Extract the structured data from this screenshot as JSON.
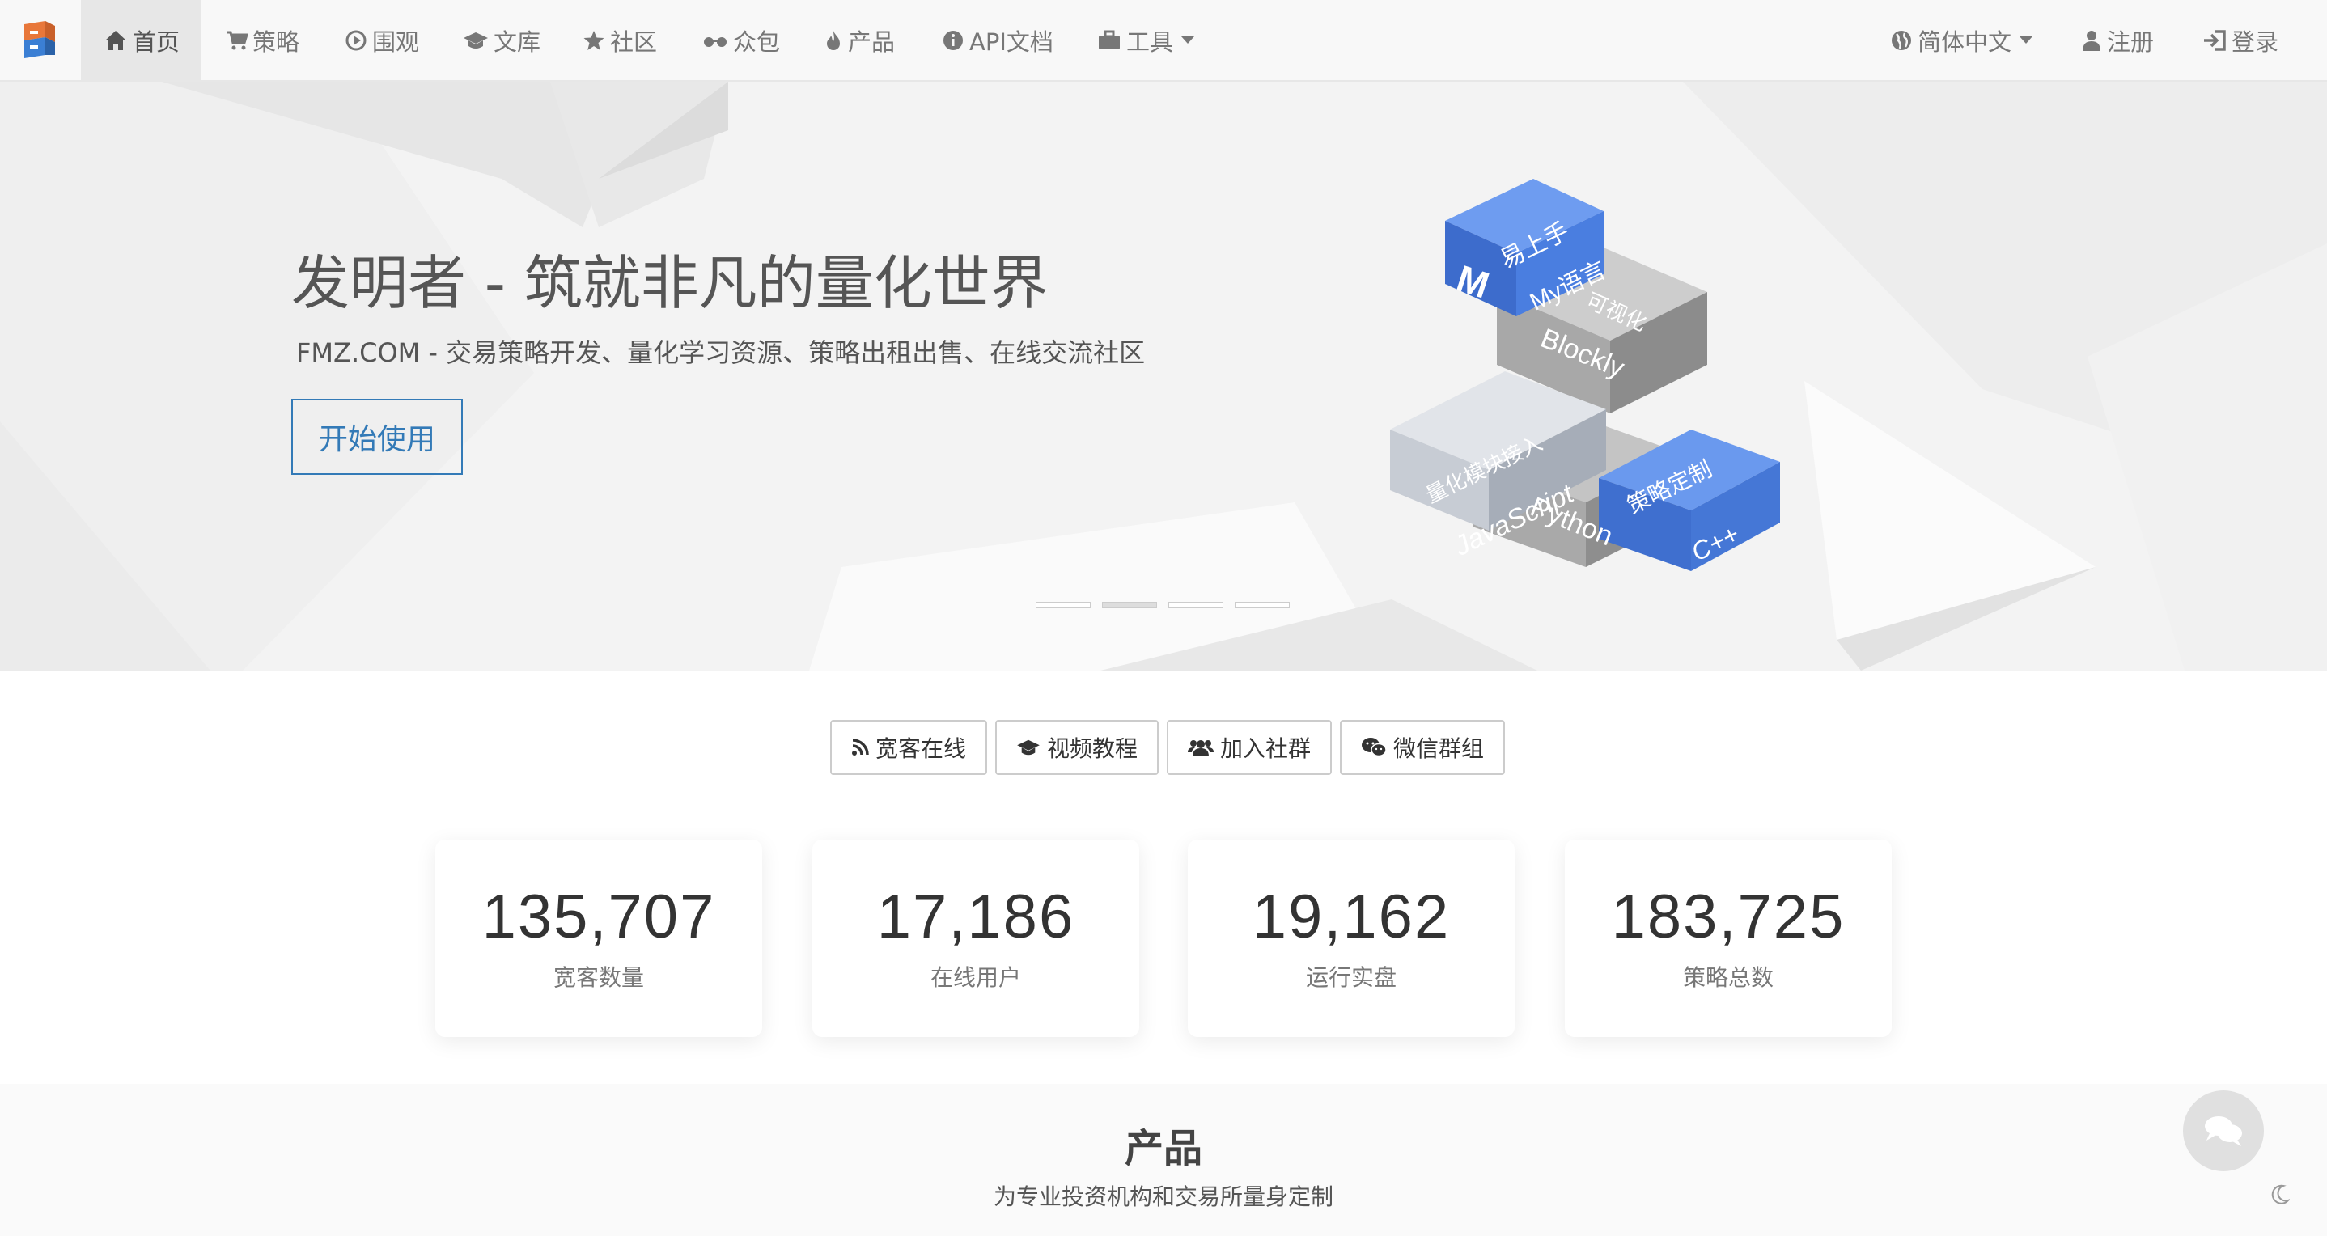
{
  "nav": {
    "items": [
      {
        "label": "首页",
        "icon": "home-icon",
        "active": true
      },
      {
        "label": "策略",
        "icon": "cart-icon"
      },
      {
        "label": "围观",
        "icon": "play-circle-icon"
      },
      {
        "label": "文库",
        "icon": "graduation-cap-icon"
      },
      {
        "label": "社区",
        "icon": "star-icon"
      },
      {
        "label": "众包",
        "icon": "glasses-icon"
      },
      {
        "label": "产品",
        "icon": "fire-icon"
      },
      {
        "label": "API文档",
        "icon": "info-icon"
      },
      {
        "label": "工具",
        "icon": "briefcase-icon",
        "dropdown": true
      }
    ],
    "right": [
      {
        "label": "简体中文",
        "icon": "globe-icon",
        "dropdown": true
      },
      {
        "label": "注册",
        "icon": "user-icon"
      },
      {
        "label": "登录",
        "icon": "login-icon"
      }
    ]
  },
  "hero": {
    "title": "发明者 - 筑就非凡的量化世界",
    "subtitle": "FMZ.COM - 交易策略开发、量化学习资源、策略出租出售、在线交流社区",
    "cta": "开始使用",
    "slides": 4,
    "active_slide": 2,
    "blocks": {
      "easy": "易上手",
      "my": "My语言",
      "m": "M",
      "visual": "可视化",
      "blockly": "Blockly",
      "quant": "量化模块接入",
      "js": "JavaScript",
      "custom": "策略定制",
      "cpp": "C++",
      "python": "Python"
    }
  },
  "links": [
    {
      "label": "宽客在线",
      "icon": "rss-icon"
    },
    {
      "label": "视频教程",
      "icon": "graduation-cap-icon"
    },
    {
      "label": "加入社群",
      "icon": "users-icon"
    },
    {
      "label": "微信群组",
      "icon": "wechat-icon"
    }
  ],
  "stats": [
    {
      "value": "135,707",
      "label": "宽客数量"
    },
    {
      "value": "17,186",
      "label": "在线用户"
    },
    {
      "value": "19,162",
      "label": "运行实盘"
    },
    {
      "value": "183,725",
      "label": "策略总数"
    }
  ],
  "products": {
    "title": "产品",
    "subtitle": "为专业投资机构和交易所量身定制"
  },
  "colors": {
    "accent": "#337ab7",
    "block_blue": "#4a86e8",
    "block_gray": "#9e9e9e"
  }
}
